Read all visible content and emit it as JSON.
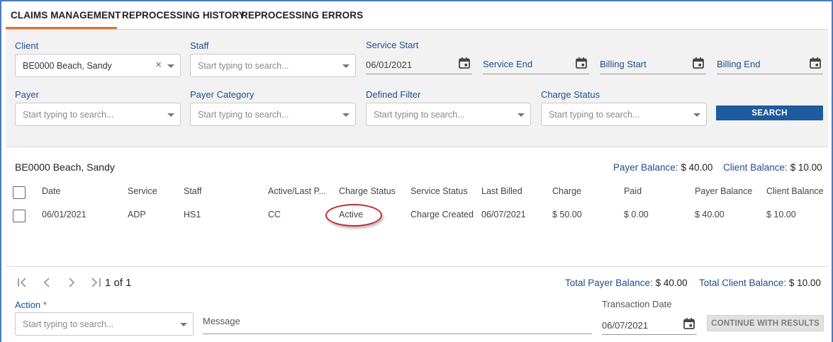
{
  "tabs": [
    {
      "label": "CLAIMS MANAGEMENT",
      "active": true
    },
    {
      "label": "REPROCESSING HISTORY",
      "active": false
    },
    {
      "label": "REPROCESSING ERRORS",
      "active": false
    }
  ],
  "filters": {
    "client": {
      "label": "Client",
      "value": "BE0000 Beach, Sandy"
    },
    "staff": {
      "label": "Staff",
      "placeholder": "Start typing to search..."
    },
    "service_start": {
      "label": "Service Start",
      "value": "06/01/2021"
    },
    "service_end": {
      "label": "Service End"
    },
    "billing_start": {
      "label": "Billing Start"
    },
    "billing_end": {
      "label": "Billing End"
    },
    "payer": {
      "label": "Payer",
      "placeholder": "Start typing to search..."
    },
    "payer_category": {
      "label": "Payer Category",
      "placeholder": "Start typing to search..."
    },
    "defined_filter": {
      "label": "Defined Filter",
      "placeholder": "Start typing to search..."
    },
    "charge_status": {
      "label": "Charge Status",
      "placeholder": "Start typing to search..."
    },
    "search_label": "SEARCH"
  },
  "results": {
    "client_name": "BE0000 Beach, Sandy",
    "payer_balance_label": "Payer Balance:",
    "payer_balance": "$ 40.00",
    "client_balance_label": "Client Balance:",
    "client_balance": "$ 10.00",
    "columns": [
      "Date",
      "Service",
      "Staff",
      "Active/Last P...",
      "Charge Status",
      "Service Status",
      "Last Billed",
      "Charge",
      "Paid",
      "Payer Balance",
      "Client Balance"
    ],
    "rows": [
      [
        "06/01/2021",
        "ADP",
        "HS1",
        "CC",
        "Active",
        "Charge Created",
        "06/07/2021",
        "$ 50.00",
        "$ 0.00",
        "$ 40.00",
        "$ 10.00"
      ]
    ]
  },
  "pager": {
    "page_info": "1 of 1"
  },
  "totals": {
    "total_payer_label": "Total Payer Balance:",
    "total_payer": "$ 40.00",
    "total_client_label": "Total Client Balance:",
    "total_client": "$ 10.00"
  },
  "action_bar": {
    "action_label": "Action",
    "required_mark": "*",
    "action_placeholder": "Start typing to search...",
    "message_label": "Message",
    "transaction_date_label": "Transaction Date",
    "transaction_date": "06/07/2021",
    "continue_label": "CONTINUE WITH RESULTS"
  },
  "colors": {
    "accent_orange": "#e8702a",
    "label_blue": "#1f4e8c",
    "primary_button": "#1d5a9e",
    "annotation_red": "#c8282f"
  },
  "icons": [
    "calendar-icon",
    "chevron-down-icon",
    "clear-icon",
    "first-page-icon",
    "prev-page-icon",
    "next-page-icon",
    "last-page-icon"
  ]
}
